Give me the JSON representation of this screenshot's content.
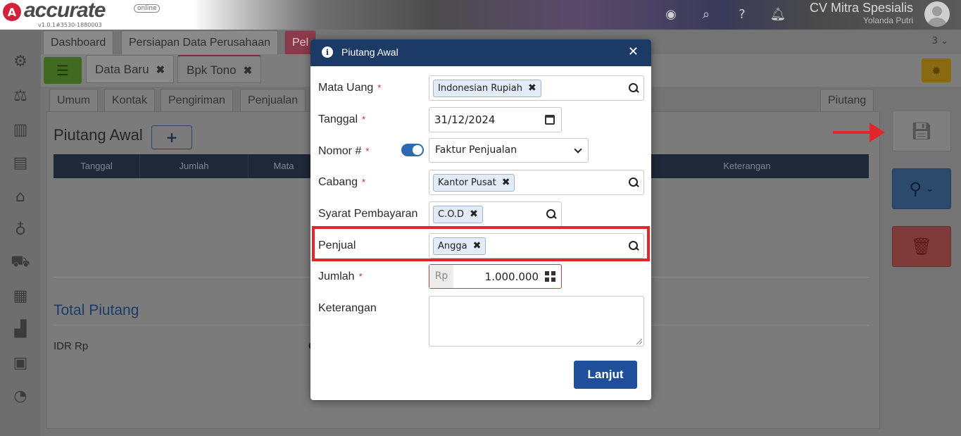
{
  "app": {
    "logo_text": "accurate",
    "logo_badge": "online",
    "version": "v1.0.1#3530-1880003",
    "company": "CV Mitra Spesialis",
    "user": "Yolanda Putri"
  },
  "tabs_top": [
    {
      "label": "Dashboard"
    },
    {
      "label": "Persiapan Data Perusahaan"
    },
    {
      "label": "Pel"
    }
  ],
  "tab_count": "3",
  "tabs_second": [
    {
      "label": "Data Baru"
    },
    {
      "label": "Bpk Tono"
    }
  ],
  "tabs_form": [
    {
      "label": "Umum"
    },
    {
      "label": "Kontak"
    },
    {
      "label": "Pengiriman"
    },
    {
      "label": "Penjualan"
    }
  ],
  "tab_right": "Piutang",
  "panel": {
    "title": "Piutang Awal",
    "plus": "+",
    "columns": [
      "Tanggal",
      "Jumlah",
      "Mata",
      "Keterangan"
    ],
    "total_title": "Total Piutang",
    "idr_label": "IDR Rp",
    "idr_value": "C"
  },
  "modal": {
    "title": "Piutang Awal",
    "close": "✕",
    "fields": {
      "mata_uang": {
        "label": "Mata Uang",
        "value": "Indonesian Rupiah"
      },
      "tanggal": {
        "label": "Tanggal",
        "value": "31/12/2024"
      },
      "nomor": {
        "label": "Nomor #",
        "value": "Faktur Penjualan"
      },
      "cabang": {
        "label": "Cabang",
        "value": "Kantor Pusat"
      },
      "syarat": {
        "label": "Syarat Pembayaran",
        "value": "C.O.D"
      },
      "penjual": {
        "label": "Penjual",
        "value": "Angga"
      },
      "jumlah": {
        "label": "Jumlah",
        "prefix": "Rp",
        "value": "1.000.000"
      },
      "keterangan": {
        "label": "Keterangan",
        "value": ""
      }
    },
    "required_mark": "*",
    "submit": "Lanjut"
  },
  "colors": {
    "modal_header": "#1c3a66",
    "accent_red": "#e3262b",
    "primary_button": "#1f4e9a"
  }
}
